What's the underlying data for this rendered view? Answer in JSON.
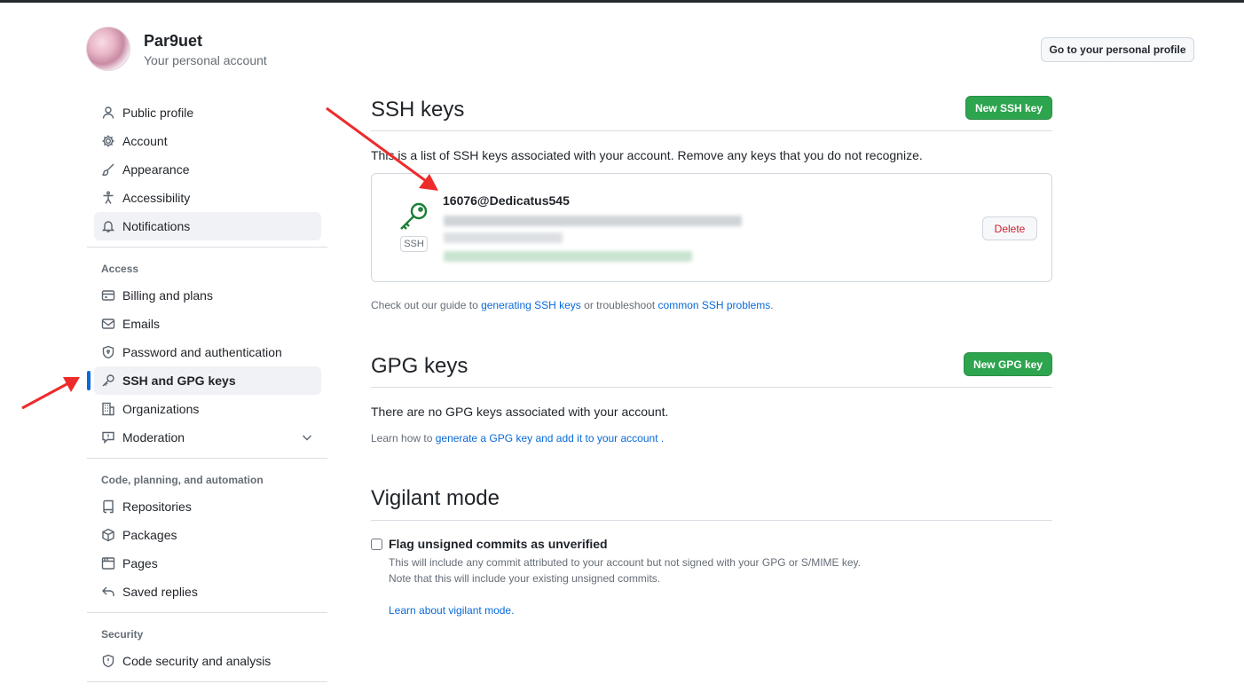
{
  "header": {
    "username": "Par9uet",
    "subtitle": "Your personal account",
    "profile_button": "Go to your personal profile"
  },
  "sidebar": {
    "items_top": [
      {
        "label": "Public profile",
        "icon": "person-icon"
      },
      {
        "label": "Account",
        "icon": "gear-icon"
      },
      {
        "label": "Appearance",
        "icon": "paintbrush-icon"
      },
      {
        "label": "Accessibility",
        "icon": "accessibility-icon"
      },
      {
        "label": "Notifications",
        "icon": "bell-icon"
      }
    ],
    "access_heading": "Access",
    "items_access": [
      {
        "label": "Billing and plans",
        "icon": "credit-card-icon"
      },
      {
        "label": "Emails",
        "icon": "mail-icon"
      },
      {
        "label": "Password and authentication",
        "icon": "shield-lock-icon"
      },
      {
        "label": "SSH and GPG keys",
        "icon": "key-icon"
      },
      {
        "label": "Organizations",
        "icon": "organization-icon"
      },
      {
        "label": "Moderation",
        "icon": "report-icon"
      }
    ],
    "code_heading": "Code, planning, and automation",
    "items_code": [
      {
        "label": "Repositories",
        "icon": "repo-icon"
      },
      {
        "label": "Packages",
        "icon": "package-icon"
      },
      {
        "label": "Pages",
        "icon": "browser-icon"
      },
      {
        "label": "Saved replies",
        "icon": "reply-icon"
      }
    ],
    "security_heading": "Security",
    "items_security": [
      {
        "label": "Code security and analysis",
        "icon": "shield-icon"
      }
    ]
  },
  "ssh": {
    "title": "SSH keys",
    "new_button": "New SSH key",
    "description": "This is a list of SSH keys associated with your account. Remove any keys that you do not recognize.",
    "key_title": "16076@Dedicatus545",
    "key_type": "SSH",
    "delete_button": "Delete",
    "guide_prefix": "Check out our guide to ",
    "guide_link1": "generating SSH keys",
    "guide_middle": " or troubleshoot ",
    "guide_link2": "common SSH problems",
    "guide_suffix": "."
  },
  "gpg": {
    "title": "GPG keys",
    "new_button": "New GPG key",
    "empty_text": "There are no GPG keys associated with your account.",
    "learn_prefix": "Learn how to ",
    "learn_link": "generate a GPG key and add it to your account",
    "learn_suffix": " ."
  },
  "vigilant": {
    "title": "Vigilant mode",
    "checkbox_label": "Flag unsigned commits as unverified",
    "checked": false,
    "note1": "This will include any commit attributed to your account but not signed with your GPG or S/MIME key.",
    "note2": "Note that this will include your existing unsigned commits.",
    "learn_link": "Learn about vigilant mode."
  },
  "colors": {
    "accent": "#0969da",
    "primary_button": "#2da44e",
    "danger": "#cf222e",
    "annotation_arrow": "#ee2b2b"
  }
}
